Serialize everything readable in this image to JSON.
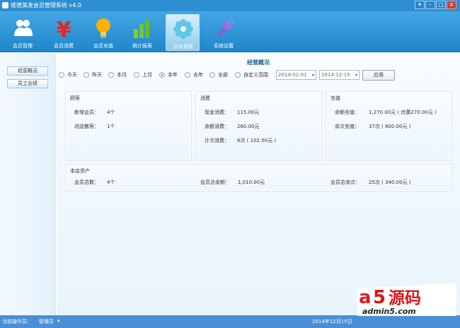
{
  "window": {
    "title": "维德美发会员管理系统 v4.0",
    "controls": [
      "▾",
      "–",
      "□",
      "×"
    ]
  },
  "toolbar": {
    "items": [
      {
        "label": "会员管理",
        "icon": "members-icon"
      },
      {
        "label": "会员消费",
        "icon": "yen-icon"
      },
      {
        "label": "会员充值",
        "icon": "lightbulb-icon"
      },
      {
        "label": "统计报表",
        "icon": "bar-chart-icon"
      },
      {
        "label": "店长看板",
        "icon": "flower-icon"
      },
      {
        "label": "系统设置",
        "icon": "wrench-icon"
      }
    ],
    "active_index": 4
  },
  "sidebar": {
    "items": [
      "经营概况",
      "员工业绩"
    ]
  },
  "main": {
    "title": "经营概况",
    "filters": {
      "options": [
        "今天",
        "昨天",
        "本月",
        "上月",
        "本年",
        "去年",
        "全部",
        "自定义范围"
      ],
      "selected": "本年",
      "date_from": "2014-01-01",
      "date_to": "2014-12-15",
      "apply_label": "应用"
    },
    "panels": {
      "customers": {
        "title": "顾客",
        "rows": [
          {
            "label": "新增会员：",
            "value": "4个"
          },
          {
            "label": "进店散客：",
            "value": "1个"
          }
        ]
      },
      "consumption": {
        "title": "消费",
        "rows": [
          {
            "label": "现金消费：",
            "value": "115.00元"
          },
          {
            "label": "余额消费：",
            "value": "260.00元"
          },
          {
            "label": "计次消费：",
            "value": "6次 ( 102.50元 )"
          }
        ]
      },
      "recharge": {
        "title": "充值",
        "rows": [
          {
            "label": "余额充值：",
            "value": "1,270.00元 ( 优惠270.00元 )"
          },
          {
            "label": "余次充值：",
            "value": "37次 ( 600.00元 )"
          }
        ]
      },
      "assets": {
        "title": "本店资产",
        "rows": [
          {
            "label": "会员总数：",
            "value": "4个"
          },
          {
            "label": "会员总余额：",
            "value": "1,010.00元"
          },
          {
            "label": "会员总余次：",
            "value": "25次 ( 340.00元 )"
          }
        ]
      }
    }
  },
  "statusbar": {
    "operator_label": "当前操作员：",
    "operator_name": "管理员",
    "date": "2014年12月15日"
  },
  "watermark": {
    "text": "a5源码",
    "url": "admin5.com"
  },
  "colors": {
    "title_bar": "#2d8fd1",
    "toolbar_top": "#42a7e3",
    "toolbar_bottom": "#1f86cb",
    "status_bar": "#4a8fd5",
    "watermark_red": "#e31b23"
  }
}
